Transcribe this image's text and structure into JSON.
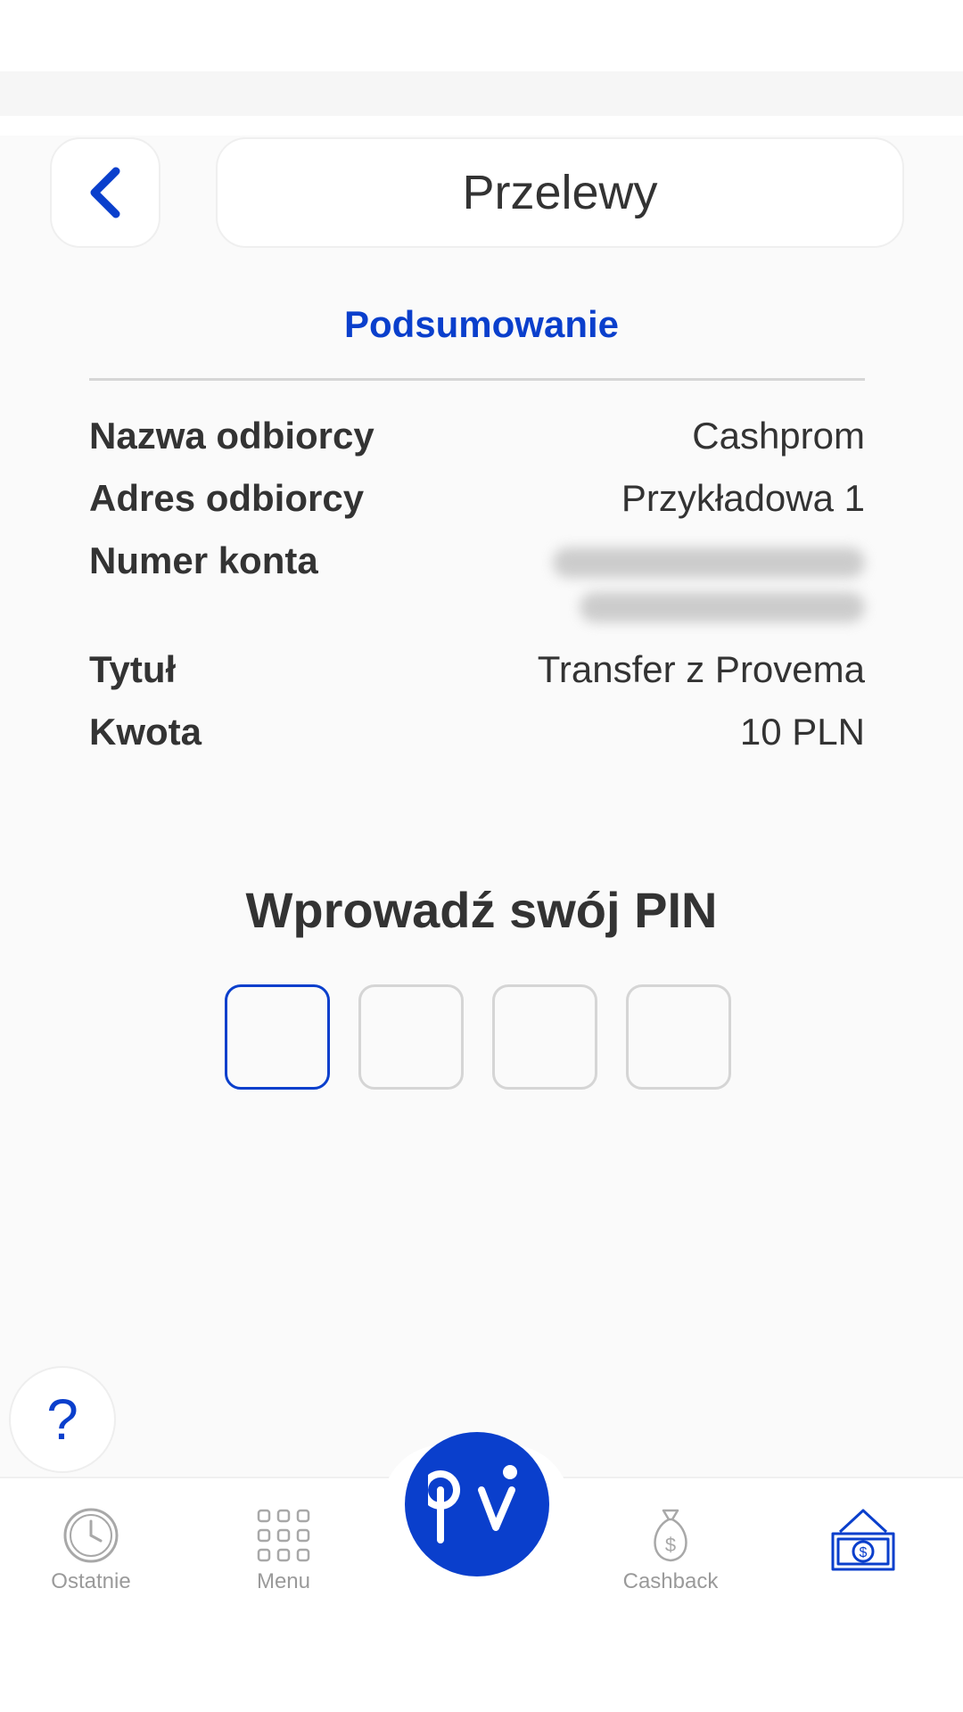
{
  "header": {
    "title": "Przelewy"
  },
  "summary": {
    "section_title": "Podsumowanie",
    "rows": [
      {
        "label": "Nazwa odbiorcy",
        "value": "Cashprom"
      },
      {
        "label": "Adres odbiorcy",
        "value": "Przykładowa 1"
      },
      {
        "label": "Numer konta",
        "value": ""
      },
      {
        "label": "Tytuł",
        "value": "Transfer z Provema"
      },
      {
        "label": "Kwota",
        "value": "10 PLN"
      }
    ]
  },
  "pin": {
    "title": "Wprowadź swój PIN",
    "digits": [
      "",
      "",
      "",
      ""
    ]
  },
  "help": {
    "label": "?"
  },
  "nav": {
    "items": [
      {
        "label": "Ostatnie",
        "icon": "clock-icon"
      },
      {
        "label": "Menu",
        "icon": "grid-icon"
      },
      {
        "label": "",
        "icon": "provema-logo"
      },
      {
        "label": "Cashback",
        "icon": "money-bag-icon"
      },
      {
        "label": "",
        "icon": "money-transfer-icon"
      }
    ]
  },
  "colors": {
    "accent": "#0a3fcc",
    "text": "#333333",
    "muted": "#9a9a9a",
    "border": "#d5d5d5"
  }
}
